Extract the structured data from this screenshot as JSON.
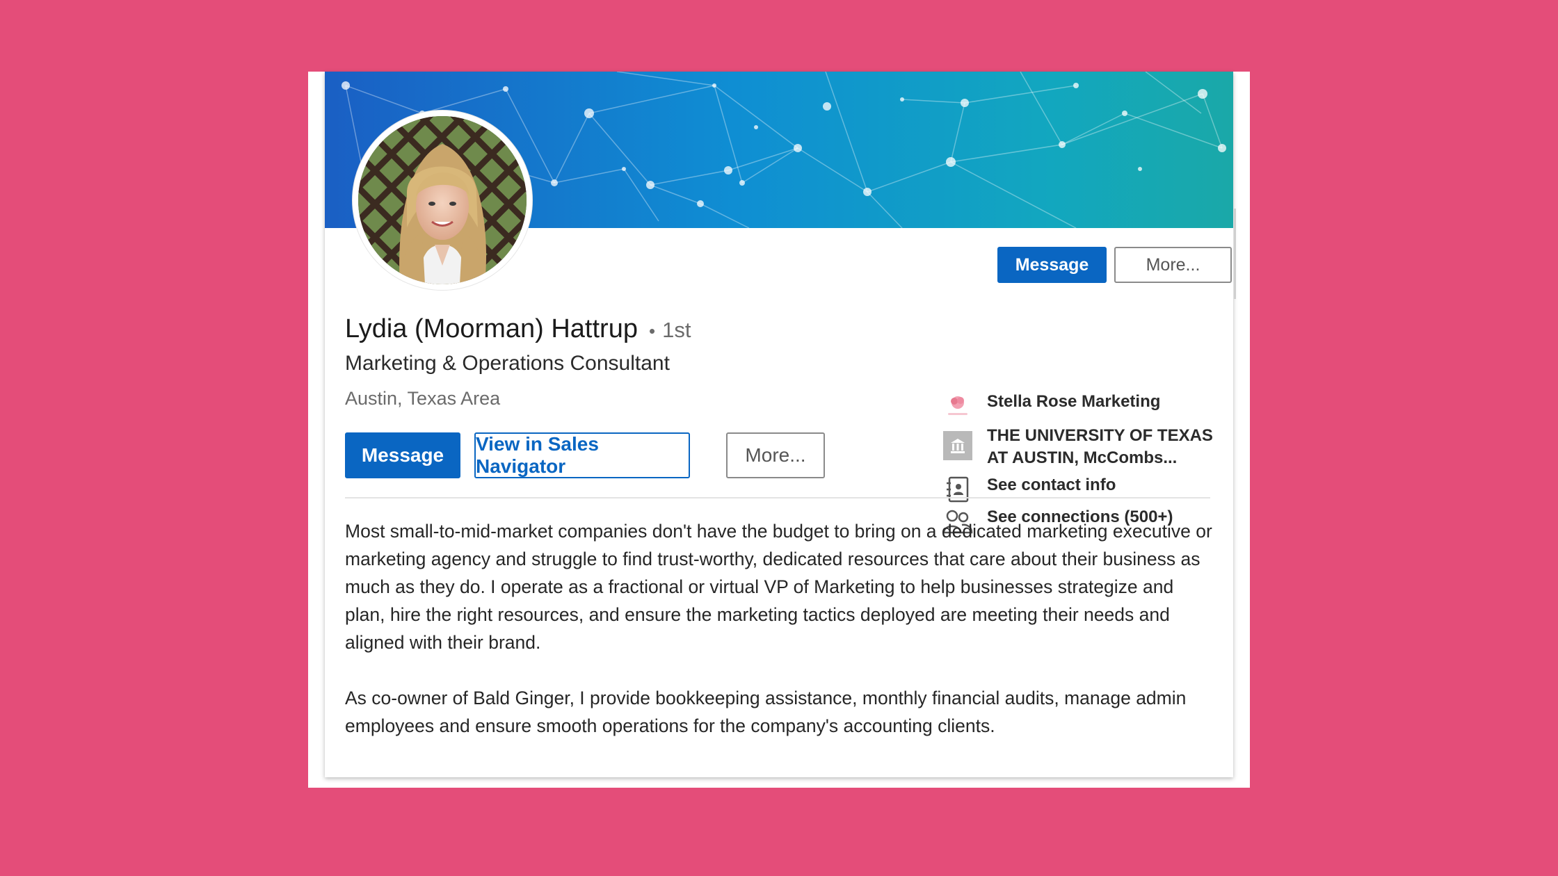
{
  "profile": {
    "name": "Lydia (Moorman) Hattrup",
    "degree_separator": "•",
    "degree": "1st",
    "headline": "Marketing & Operations Consultant",
    "location": "Austin, Texas Area"
  },
  "top_actions": {
    "message_label": "Message",
    "more_label": "More..."
  },
  "actions": {
    "message_label": "Message",
    "sales_navigator_label": "View in Sales Navigator",
    "more_label": "More..."
  },
  "sidebar": {
    "items": [
      {
        "label": "Stella Rose Marketing",
        "icon": "company-logo-icon"
      },
      {
        "label": "THE UNIVERSITY OF TEXAS",
        "label_line2": "AT AUSTIN, McCombs...",
        "icon": "school-icon"
      },
      {
        "label": "See contact info",
        "icon": "contact-card-icon"
      },
      {
        "label": "See connections (500+)",
        "icon": "connections-icon"
      }
    ]
  },
  "summary": {
    "paragraphs": [
      "Most small-to-mid-market companies don't have the budget to bring on a dedicated marketing executive or marketing agency and struggle to find trust-worthy, dedicated resources that care about their business as much as they do. I operate as a fractional or virtual VP of Marketing to help businesses strategize and plan, hire the right resources, and ensure the marketing tactics deployed are meeting their needs and aligned with their brand.",
      "As co-owner of Bald Ginger, I provide bookkeeping assistance, monthly financial audits, manage admin employees and ensure smooth operations for the company's accounting clients."
    ]
  },
  "colors": {
    "page_background": "#E44D79",
    "primary": "#0A66C2",
    "banner_start": "#1a5fc4",
    "banner_end": "#1aa8a8"
  }
}
